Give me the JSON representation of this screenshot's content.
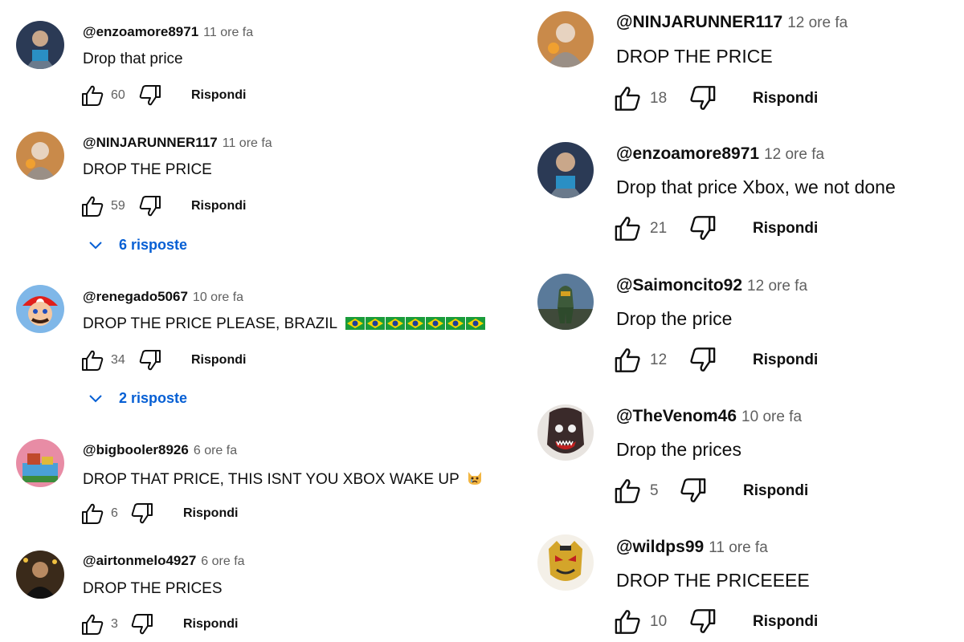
{
  "left_comments": [
    {
      "author": "@enzoamore8971",
      "time": "11 ore fa",
      "text": "Drop that price",
      "likes": "60",
      "reply_label": "Rispondi"
    },
    {
      "author": "@NINJARUNNER117",
      "time": "11 ore fa",
      "text": "DROP THE PRICE",
      "likes": "59",
      "reply_label": "Rispondi",
      "replies": "6 risposte"
    },
    {
      "author": "@renegado5067",
      "time": "10 ore fa",
      "text": "DROP THE PRICE PLEASE, BRAZIL",
      "likes": "34",
      "reply_label": "Rispondi",
      "replies": "2 risposte",
      "emoji": "brazil-flag x7"
    },
    {
      "author": "@bigbooler8926",
      "time": "6 ore fa",
      "text": "DROP THAT PRICE, THIS ISNT YOU XBOX WAKE UP",
      "likes": "6",
      "reply_label": "Rispondi",
      "emoji": "crying-cat-face"
    },
    {
      "author": "@airtonmelo4927",
      "time": "6 ore fa",
      "text": "DROP THE PRICES",
      "likes": "3",
      "reply_label": "Rispondi"
    }
  ],
  "right_comments": [
    {
      "author": "@NINJARUNNER117",
      "time": "12 ore fa",
      "text": "DROP THE PRICE",
      "likes": "18",
      "reply_label": "Rispondi"
    },
    {
      "author": "@enzoamore8971",
      "time": "12 ore fa",
      "text": "Drop that price Xbox, we not done",
      "likes": "21",
      "reply_label": "Rispondi"
    },
    {
      "author": "@Saimoncito92",
      "time": "12 ore fa",
      "text": "Drop the price",
      "likes": "12",
      "reply_label": "Rispondi"
    },
    {
      "author": "@TheVenom46",
      "time": "10 ore fa",
      "text": "Drop the prices",
      "likes": "5",
      "reply_label": "Rispondi"
    },
    {
      "author": "@wildps99",
      "time": "11 ore fa",
      "text": "DROP THE PRICEEEE",
      "likes": "10",
      "reply_label": "Rispondi"
    }
  ],
  "colors": {
    "link_blue": "#065fd4",
    "meta_gray": "#606060",
    "text": "#0f0f0f"
  },
  "icons": [
    "thumb-up-icon",
    "thumb-down-icon",
    "chevron-down-icon"
  ]
}
